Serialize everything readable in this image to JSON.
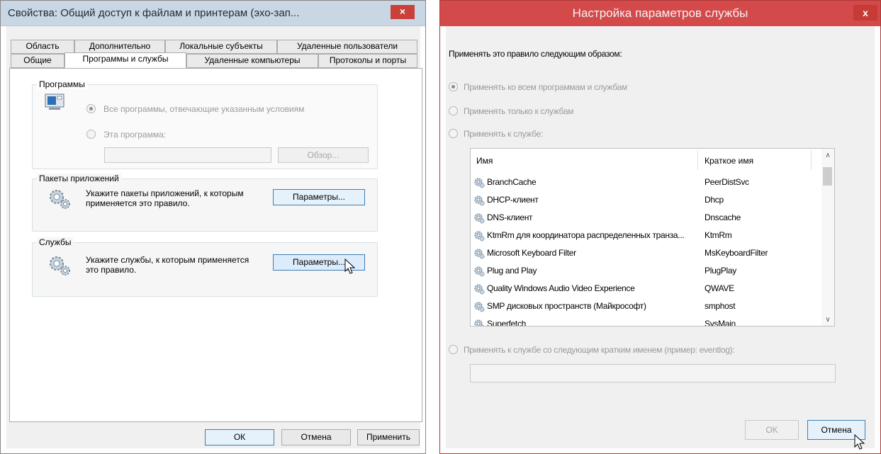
{
  "left_dialog": {
    "title": "Свойства: Общий доступ к файлам и принтерам (эхо-зап...",
    "close_glyph": "×",
    "tabs_row1": [
      "Область",
      "Дополнительно",
      "Локальные субъекты",
      "Удаленные пользователи"
    ],
    "tabs_row2": [
      "Общие",
      "Программы и службы",
      "Удаленные компьютеры",
      "Протоколы и порты"
    ],
    "selected_tab": "Программы и службы",
    "programs": {
      "title": "Программы",
      "radio_all": "Все программы, отвечающие указанным условиям",
      "radio_this": "Эта программа:",
      "path_value": "",
      "browse": "Обзор..."
    },
    "packages": {
      "title": "Пакеты приложений",
      "text": "Укажите пакеты приложений, к которым применяется это правило.",
      "button": "Параметры..."
    },
    "services": {
      "title": "Службы",
      "text": "Укажите службы, к которым применяется это правило.",
      "button": "Параметры..."
    },
    "buttons": {
      "ok": "ОК",
      "cancel": "Отмена",
      "apply": "Применить"
    }
  },
  "right_dialog": {
    "title": "Настройка параметров службы",
    "close_glyph": "x",
    "prompt": "Применять это правило следующим образом:",
    "options": {
      "all": "Применять ко всем программам и службам",
      "only_services": "Применять только к службам",
      "to_service": "Применять к службе:",
      "by_short_name": "Применять к службе со следующим кратким именем (пример: eventlog):"
    },
    "columns": {
      "name": "Имя",
      "short_name": "Краткое имя"
    },
    "rows": [
      {
        "name": "BranchCache",
        "short": "PeerDistSvc"
      },
      {
        "name": "DHCP-клиент",
        "short": "Dhcp"
      },
      {
        "name": "DNS-клиент",
        "short": "Dnscache"
      },
      {
        "name": "KtmRm для координатора распределенных транза...",
        "short": "KtmRm"
      },
      {
        "name": "Microsoft Keyboard Filter",
        "short": "MsKeyboardFilter"
      },
      {
        "name": "Plug and Play",
        "short": "PlugPlay"
      },
      {
        "name": "Quality Windows Audio Video Experience",
        "short": "QWAVE"
      },
      {
        "name": "SMP дисковых пространств (Майкрософт)",
        "short": "smphost"
      },
      {
        "name": "Superfetch",
        "short": "SysMain"
      }
    ],
    "short_name_value": "",
    "buttons": {
      "ok": "OK",
      "cancel": "Отмена"
    }
  }
}
